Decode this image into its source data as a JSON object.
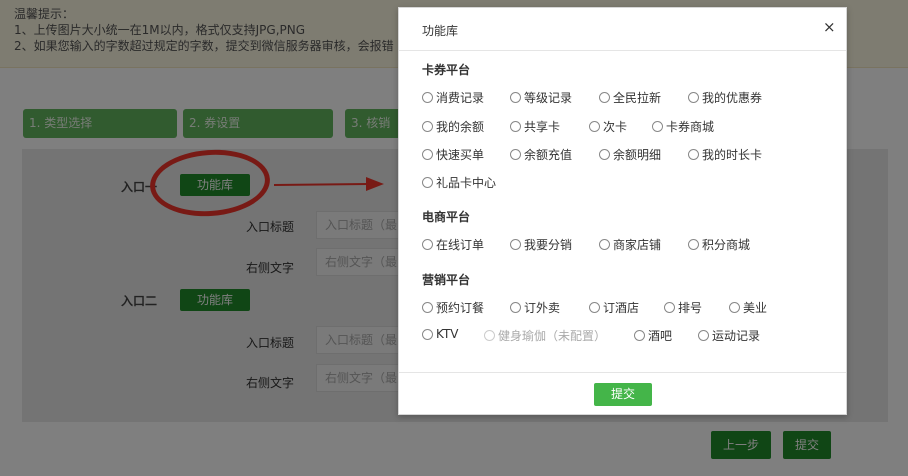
{
  "tips": {
    "title": "温馨提示：",
    "line1": "1、上传图片大小统一在1M以内，格式仅支持JPG,PNG",
    "line2": "2、如果您输入的字数超过规定的字数，提交到微信服务器审核，会报错"
  },
  "steps": [
    "1. 类型选择",
    "2. 券设置",
    "3. 核销"
  ],
  "entry1": {
    "label": "入口一",
    "lib_button": "功能库",
    "title_label": "入口标题",
    "title_placeholder": "入口标题（最",
    "right_label": "右侧文字",
    "right_placeholder": "右侧文字（最"
  },
  "entry2": {
    "label": "入口二",
    "lib_button": "功能库",
    "title_label": "入口标题",
    "title_placeholder": "入口标题（最",
    "right_label": "右侧文字",
    "right_placeholder": "右侧文字（最"
  },
  "page_buttons": {
    "prev": "上一步",
    "submit": "提交"
  },
  "modal": {
    "title": "功能库",
    "close": "×",
    "submit": "提交",
    "sections": {
      "card": {
        "title": "卡券平台",
        "options": [
          "消费记录",
          "等级记录",
          "全民拉新",
          "我的优惠券",
          "我的余额",
          "共享卡",
          "次卡",
          "卡券商城",
          "快速买单",
          "余额充值",
          "余额明细",
          "我的时长卡",
          "礼品卡中心"
        ]
      },
      "ecommerce": {
        "title": "电商平台",
        "options": [
          "在线订单",
          "我要分销",
          "商家店铺",
          "积分商城"
        ]
      },
      "marketing": {
        "title": "营销平台",
        "options": [
          "预约订餐",
          "订外卖",
          "订酒店",
          "排号",
          "美业",
          "KTV",
          "健身瑜伽（未配置）",
          "酒吧",
          "运动记录"
        ]
      }
    }
  },
  "colors": {
    "primary_green": "#218c2b",
    "step_green": "#62b65e",
    "modal_button_green": "#44b549",
    "annotation_red": "#f0342a",
    "tips_bg": "#fcf8e3"
  }
}
